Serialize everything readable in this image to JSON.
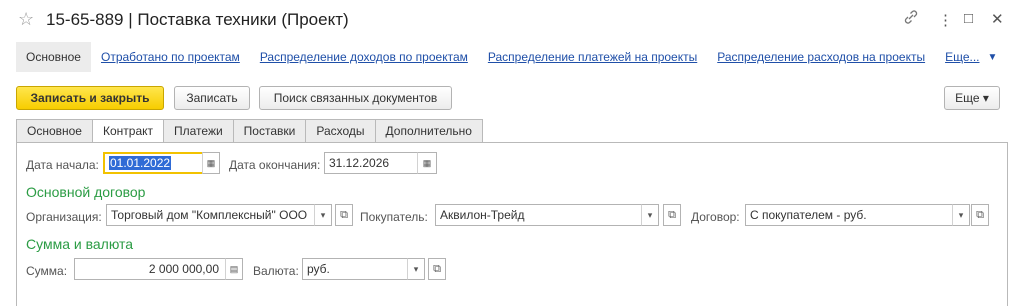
{
  "window": {
    "title": "15-65-889 | Поставка техники (Проект)",
    "star_icon": "☆",
    "link_icon": "🔗",
    "more_icon": "⋮",
    "maximize_icon": "□",
    "close_icon": "✕"
  },
  "navbar": {
    "items": [
      "Основное",
      "Отработано по проектам",
      "Распределение доходов по проектам",
      "Распределение платежей на проекты",
      "Распределение расходов на проекты",
      "Еще..."
    ],
    "more_arrow": "▼"
  },
  "toolbar": {
    "save_close": "Записать и закрыть",
    "save": "Записать",
    "find_related": "Поиск связанных документов",
    "more": "Еще ▾"
  },
  "tabs": [
    "Основное",
    "Контракт",
    "Платежи",
    "Поставки",
    "Расходы",
    "Дополнительно"
  ],
  "form": {
    "start_date_label": "Дата начала:",
    "start_date": "01.01.2022",
    "end_date_label": "Дата окончания:",
    "end_date": "31.12.2026",
    "main_contract_header": "Основной договор",
    "organization_label": "Организация:",
    "organization": "Торговый дом \"Комплексный\" ООО",
    "buyer_label": "Покупатель:",
    "buyer": "Аквилон-Трейд",
    "contract_label": "Договор:",
    "contract": "С покупателем - руб.",
    "sum_header": "Сумма и валюта",
    "sum_label": "Сумма:",
    "sum": "2 000 000,00",
    "currency_label": "Валюта:",
    "currency": "руб."
  },
  "icons": {
    "calendar": "▦",
    "dropdown": "▾",
    "open": "⧉",
    "calculator": "▤"
  },
  "colors": {
    "accent_yellow": "#f7cd00",
    "link_blue": "#1f4fa8",
    "section_green": "#2b9c44",
    "selection_blue": "#2f6bd6"
  }
}
